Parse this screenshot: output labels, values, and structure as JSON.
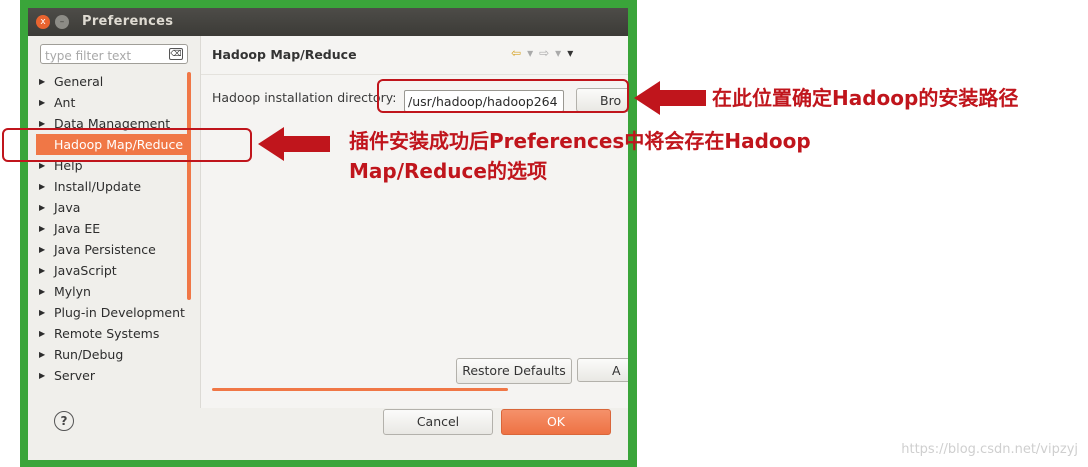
{
  "window": {
    "title": "Preferences",
    "close_glyph": "x",
    "minimize_glyph": "–"
  },
  "sidebar": {
    "filter_placeholder": "type filter text",
    "clear_glyph": "⌫",
    "items": [
      {
        "label": "General",
        "arrow": "▶"
      },
      {
        "label": "Ant",
        "arrow": "▶"
      },
      {
        "label": "Data Management",
        "arrow": "▶"
      },
      {
        "label": "Hadoop Map/Reduce",
        "arrow": ""
      },
      {
        "label": "Help",
        "arrow": "▶"
      },
      {
        "label": "Install/Update",
        "arrow": "▶"
      },
      {
        "label": "Java",
        "arrow": "▶"
      },
      {
        "label": "Java EE",
        "arrow": "▶"
      },
      {
        "label": "Java Persistence",
        "arrow": "▶"
      },
      {
        "label": "JavaScript",
        "arrow": "▶"
      },
      {
        "label": "Mylyn",
        "arrow": "▶"
      },
      {
        "label": "Plug-in Development",
        "arrow": "▶"
      },
      {
        "label": "Remote Systems",
        "arrow": "▶"
      },
      {
        "label": "Run/Debug",
        "arrow": "▶"
      },
      {
        "label": "Server",
        "arrow": "▶"
      }
    ],
    "selected_index": 3
  },
  "content": {
    "page_title": "Hadoop Map/Reduce",
    "dir_label": "Hadoop installation directory:",
    "dir_value": "/usr/hadoop/hadoop264",
    "browse_label": "Bro",
    "restore_label": "Restore Defaults",
    "apply_label": "A",
    "nav": {
      "back": "⇦",
      "dropdown": "▾",
      "forward": "⇨",
      "menu": "▾"
    }
  },
  "footer": {
    "help_glyph": "?",
    "cancel_label": "Cancel",
    "ok_label": "OK"
  },
  "annotations": {
    "top_right": "在此位置确定Hadoop的安装路径",
    "middle_line1": "插件安装成功后Preferences中将会存在Hadoop",
    "middle_line2": "Map/Reduce的选项"
  },
  "watermark": "https://blog.csdn.net/vipzyj",
  "colors": {
    "frame_green": "#3aa53a",
    "accent_orange": "#f07746",
    "annotation_red": "#c0151c"
  }
}
